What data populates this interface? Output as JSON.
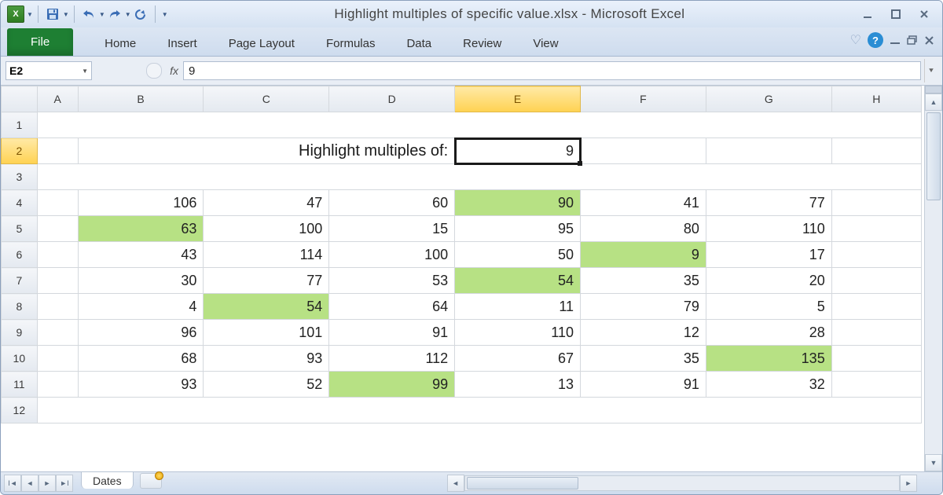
{
  "title": "Highlight multiples of specific value.xlsx - Microsoft Excel",
  "ribbon": {
    "file": "File",
    "home": "Home",
    "insert": "Insert",
    "pagelayout": "Page Layout",
    "formulas": "Formulas",
    "data": "Data",
    "review": "Review",
    "view": "View"
  },
  "namebox": "E2",
  "fx": "fx",
  "formula": "9",
  "columns": [
    "A",
    "B",
    "C",
    "D",
    "E",
    "F",
    "G",
    "H"
  ],
  "rows": [
    "1",
    "2",
    "3",
    "4",
    "5",
    "6",
    "7",
    "8",
    "9",
    "10",
    "11",
    "12"
  ],
  "label_row2": "Highlight multiples of:",
  "active_cell_value": "9",
  "grid": {
    "r4": {
      "B": 106,
      "C": 47,
      "D": 60,
      "E": 90,
      "F": 41,
      "G": 77
    },
    "r5": {
      "B": 63,
      "C": 100,
      "D": 15,
      "E": 95,
      "F": 80,
      "G": 110
    },
    "r6": {
      "B": 43,
      "C": 114,
      "D": 100,
      "E": 50,
      "F": 9,
      "G": 17
    },
    "r7": {
      "B": 30,
      "C": 77,
      "D": 53,
      "E": 54,
      "F": 35,
      "G": 20
    },
    "r8": {
      "B": 4,
      "C": 54,
      "D": 64,
      "E": 11,
      "F": 79,
      "G": 5
    },
    "r9": {
      "B": 96,
      "C": 101,
      "D": 91,
      "E": 110,
      "F": 12,
      "G": 28
    },
    "r10": {
      "B": 68,
      "C": 93,
      "D": 112,
      "E": 67,
      "F": 35,
      "G": 135
    },
    "r11": {
      "B": 93,
      "C": 52,
      "D": 99,
      "E": 13,
      "F": 91,
      "G": 32
    }
  },
  "highlights": [
    "r4.E",
    "r5.B",
    "r6.F",
    "r7.E",
    "r8.C",
    "r10.G",
    "r11.D"
  ],
  "sheet_tab": "Dates"
}
